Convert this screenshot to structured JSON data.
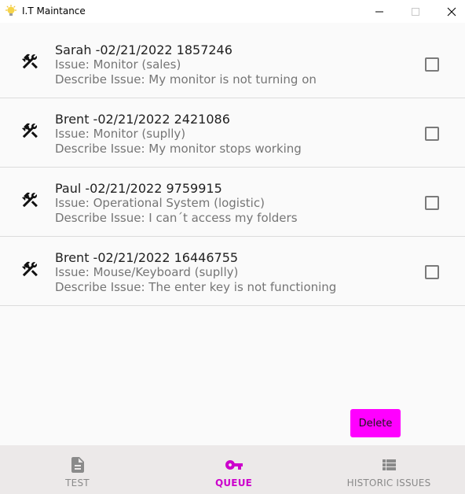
{
  "window": {
    "title": "I.T Maintance",
    "icon": "lightbulb-icon",
    "controls": [
      "minimize-icon",
      "maximize-icon",
      "close-icon"
    ]
  },
  "issues": [
    {
      "header": "Sarah -02/21/2022 1857246",
      "issue": "Issue: Monitor (sales)",
      "description": "Describe Issue: My monitor is not turning on",
      "icon": "wrench-screwdriver-icon",
      "checked": false
    },
    {
      "header": "Brent -02/21/2022 2421086",
      "issue": "Issue: Monitor (suplly)",
      "description": "Describe Issue: My monitor stops working",
      "icon": "wrench-screwdriver-icon",
      "checked": false
    },
    {
      "header": "Paul -02/21/2022 9759915",
      "issue": "Issue: Operational System (logistic)",
      "description": "Describe Issue: I can´t access my folders",
      "icon": "wrench-screwdriver-icon",
      "checked": false
    },
    {
      "header": "Brent -02/21/2022 16446755",
      "issue": "Issue: Mouse/Keyboard (suplly)",
      "description": "Describe Issue: The enter key is not functioning",
      "icon": "wrench-screwdriver-icon",
      "checked": false
    }
  ],
  "actions": {
    "delete_label": "Delete"
  },
  "bottom_nav": {
    "items": [
      {
        "label": "TEST",
        "icon": "document-icon",
        "active": false
      },
      {
        "label": "QUEUE",
        "icon": "key-icon",
        "active": true
      },
      {
        "label": "HISTORIC ISSUES",
        "icon": "list-icon",
        "active": false
      }
    ]
  },
  "colors": {
    "accent": "#ff00ff",
    "active_nav": "#cc00cc",
    "nav_background": "#ece9e9",
    "list_background": "#fafafa"
  }
}
